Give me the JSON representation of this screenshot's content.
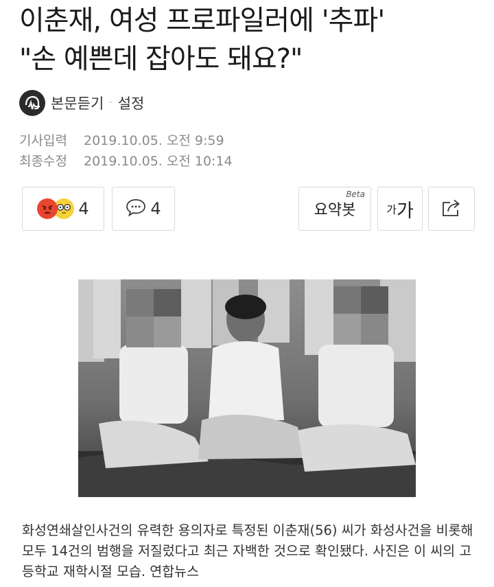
{
  "article": {
    "headline_lines": [
      "이춘재, 여성 프로파일러에 '추파'",
      "\"손 예쁜데 잡아도 돼요?\""
    ],
    "listen_label": "본문듣기",
    "separator": "·",
    "settings_label": "설정",
    "meta": [
      {
        "label": "기사입력",
        "value": "2019.10.05. 오전 9:59"
      },
      {
        "label": "최종수정",
        "value": "2019.10.05. 오전 10:14"
      }
    ],
    "reactions": {
      "count": "4",
      "icons": [
        "angry-face-icon",
        "glasses-face-icon"
      ]
    },
    "comments": {
      "count": "4",
      "icon": "speech-bubble-icon"
    },
    "summary_bot": {
      "label": "요약봇",
      "badge": "Beta"
    },
    "font_size": {
      "small": "가",
      "large": "가"
    },
    "share": {
      "icon": "share-icon"
    },
    "photo_caption": "화성연쇄살인사건의 유력한 용의자로 특정된 이춘재(56) 씨가 화성사건을 비롯해 모두 14건의 범행을 저질렀다고 최근 자백한 것으로 확인됐다. 사진은 이 씨의 고등학교 재학시절 모습. 연합뉴스"
  },
  "colors": {
    "text": "#1a1a1a",
    "meta": "#8a8a8a",
    "border": "#d9d9d9",
    "angry": "#e8462f",
    "glasses": "#f6d23a"
  }
}
